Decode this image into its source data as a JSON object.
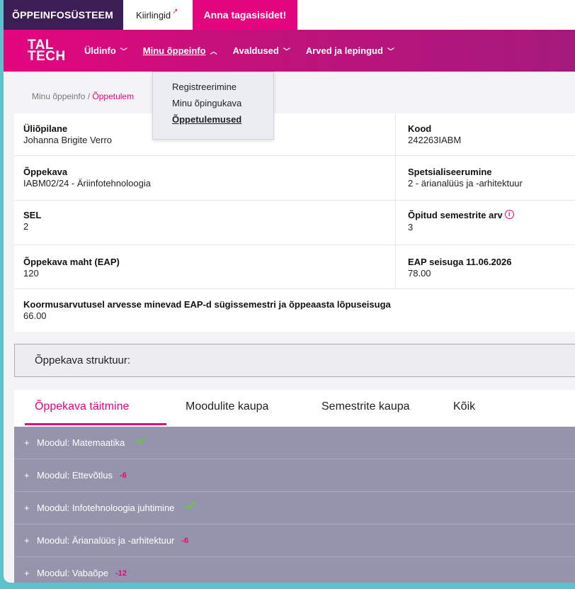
{
  "topbar": {
    "system_title": "ÕPPEINFOSÜSTEEM",
    "quicklinks": "Kiirlingid",
    "feedback": "Anna tagasisidet!"
  },
  "nav": {
    "logo_line1": "TAL",
    "logo_line2": "TECH",
    "items": [
      {
        "label": "Üldinfo"
      },
      {
        "label": "Minu õppeinfo"
      },
      {
        "label": "Avaldused"
      },
      {
        "label": "Arved ja lepingud"
      }
    ]
  },
  "dropdown": {
    "items": [
      "Registreerimine",
      "Minu õpingukava",
      "Õppetulemused"
    ]
  },
  "breadcrumb": {
    "parent": "Minu õppeinfo",
    "separator": " / ",
    "current": "Õppetulem"
  },
  "info": {
    "student_label": "Üliõpilane",
    "student_value": "Johanna Brigite Verro",
    "code_label": "Kood",
    "code_value": "242263IABM",
    "curriculum_label": "Õppekava",
    "curriculum_value": "IABM02/24 - Äriinfotehnoloogia",
    "specialization_label": "Spetsialiseerumine",
    "specialization_value": "2 - ärianalüüs ja -arhitektuur",
    "sel_label": "SEL",
    "sel_value": "2",
    "semesters_label": "Õpitud semestrite arv",
    "semesters_value": "3",
    "volume_label": "Õppekava maht (EAP)",
    "volume_value": "120",
    "eap_label": "EAP seisuga 11.06.2026",
    "eap_value": "78.00",
    "load_label": "Koormusarvutusel arvesse minevad EAP-d sügissemestri ja õppeaasta lõpuseisuga",
    "load_value": "66.00"
  },
  "structure": {
    "label": "Õppekava struktuur:"
  },
  "tabs": [
    "Õppekava täitmine",
    "Moodulite kaupa",
    "Semestrite kaupa",
    "Kõik"
  ],
  "modules": [
    {
      "name": "Moodul: Matemaatika",
      "status": "check",
      "deficit": ""
    },
    {
      "name": "Moodul: Ettevõtlus",
      "status": "deficit",
      "deficit": "-6"
    },
    {
      "name": "Moodul: Infotehnoloogia juhtimine",
      "status": "check",
      "deficit": ""
    },
    {
      "name": "Moodul: Ärianalüüs ja -arhitektuur",
      "status": "deficit",
      "deficit": "-6"
    },
    {
      "name": "Moodul: Vabaõpe",
      "status": "deficit",
      "deficit": "-12"
    }
  ],
  "colors": {
    "brand_magenta": "#e4067e",
    "brand_purple": "#3d1e54",
    "module_bg": "#9494ac",
    "check_green": "#6cc24a"
  }
}
